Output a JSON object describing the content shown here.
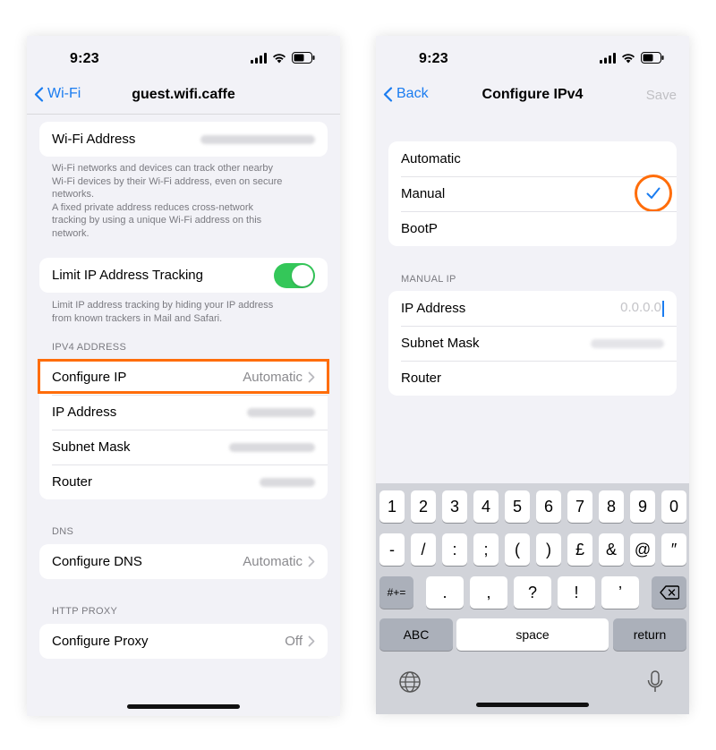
{
  "left_screen": {
    "status_time": "9:23",
    "nav": {
      "back_label": "Wi-Fi",
      "title": "guest.wifi.caffe"
    },
    "wifi_address": {
      "label": "Wi-Fi Address"
    },
    "wifi_address_note": [
      "Wi-Fi networks and devices can track other nearby",
      "Wi-Fi devices by their Wi-Fi address, even on secure",
      "networks.",
      "A fixed private address reduces cross-network",
      "tracking by using a unique Wi-Fi address on this",
      "network."
    ],
    "limit_tracking": {
      "label": "Limit IP Address Tracking",
      "enabled": true
    },
    "limit_tracking_note": [
      "Limit IP address tracking by hiding your IP address",
      "from known trackers in Mail and Safari."
    ],
    "ipv4_header": "IPV4 ADDRESS",
    "ipv4_rows": [
      {
        "label": "Configure IP",
        "value": "Automatic"
      },
      {
        "label": "IP Address"
      },
      {
        "label": "Subnet Mask"
      },
      {
        "label": "Router"
      }
    ],
    "dns_header": "DNS",
    "dns": {
      "label": "Configure DNS",
      "value": "Automatic"
    },
    "proxy_header": "HTTP PROXY",
    "proxy": {
      "label": "Configure Proxy",
      "value": "Off"
    }
  },
  "right_screen": {
    "status_time": "9:23",
    "nav": {
      "back_label": "Back",
      "title": "Configure IPv4",
      "action_label": "Save"
    },
    "modes": [
      {
        "label": "Automatic",
        "selected": false
      },
      {
        "label": "Manual",
        "selected": true
      },
      {
        "label": "BootP",
        "selected": false
      }
    ],
    "manual_header": "MANUAL IP",
    "manual_rows": [
      {
        "label": "IP Address",
        "placeholder": "0.0.0.0"
      },
      {
        "label": "Subnet Mask"
      },
      {
        "label": "Router"
      }
    ],
    "keyboard": {
      "row1": [
        "1",
        "2",
        "3",
        "4",
        "5",
        "6",
        "7",
        "8",
        "9",
        "0"
      ],
      "row2": [
        "-",
        "/",
        ":",
        ";",
        "(",
        ")",
        "£",
        "&",
        "@",
        "″"
      ],
      "row3_toggle": "#+=",
      "row3": [
        ".",
        ",",
        "?",
        "!",
        "’"
      ],
      "abc": "ABC",
      "space": "space",
      "return": "return"
    }
  },
  "colors": {
    "accent": "#1a7cf0",
    "highlight": "#ff6d0a",
    "toggle_on": "#34c759"
  },
  "icons": [
    "signal-icon",
    "wifi-icon",
    "battery-icon",
    "chevron-left-icon",
    "chevron-right-icon",
    "checkmark-icon",
    "backspace-icon",
    "globe-icon",
    "microphone-icon"
  ]
}
